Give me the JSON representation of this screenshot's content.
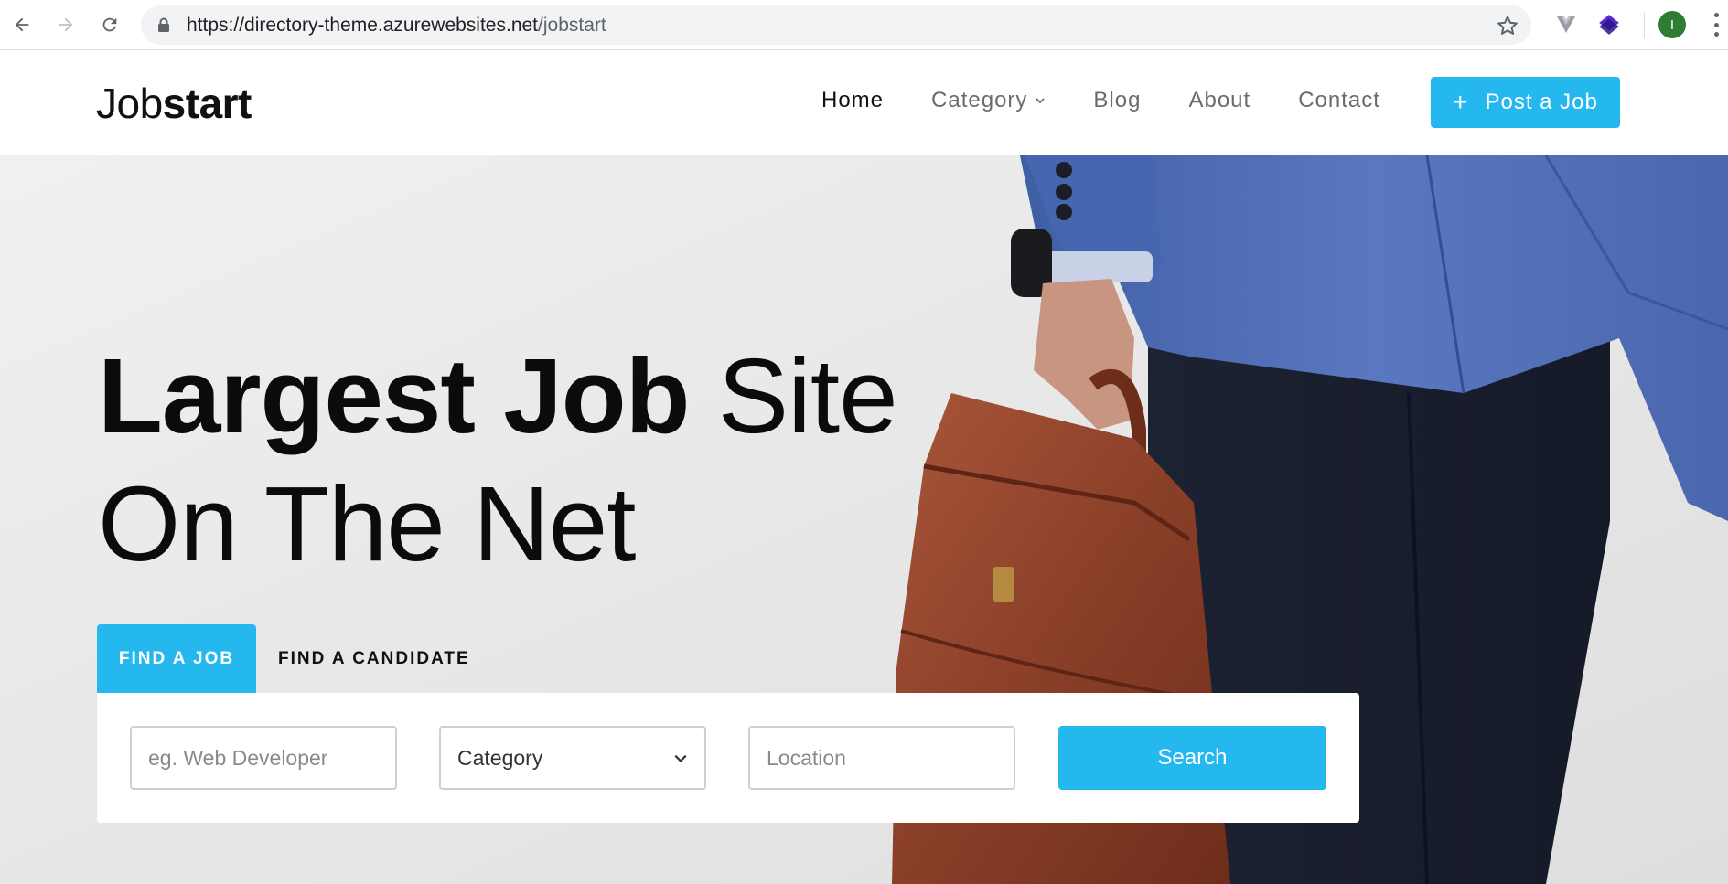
{
  "browser": {
    "url_host": "https://directory-theme.azurewebsites.net",
    "url_path": "/jobstart",
    "profile_initial": "I"
  },
  "site": {
    "logo_regular": "Job",
    "logo_bold": "start",
    "nav": [
      {
        "label": "Home",
        "active": true
      },
      {
        "label": "Category",
        "has_dropdown": true
      },
      {
        "label": "Blog"
      },
      {
        "label": "About"
      },
      {
        "label": "Contact"
      }
    ],
    "post_button": {
      "icon": "+",
      "label": "Post a Job"
    }
  },
  "hero": {
    "headline_bold": "Largest Job",
    "headline_light_1": " Site",
    "headline_line2": "On The Net",
    "tabs": [
      {
        "label": "FIND A JOB",
        "active": true
      },
      {
        "label": "FIND A CANDIDATE",
        "active": false
      }
    ],
    "search": {
      "keyword_placeholder": "eg. Web Developer",
      "category_value": "Category",
      "location_placeholder": "Location",
      "button_label": "Search"
    }
  },
  "colors": {
    "accent": "#25b8ee",
    "text_dark": "#0b0b0b",
    "nav_muted": "#6b6b6b"
  }
}
